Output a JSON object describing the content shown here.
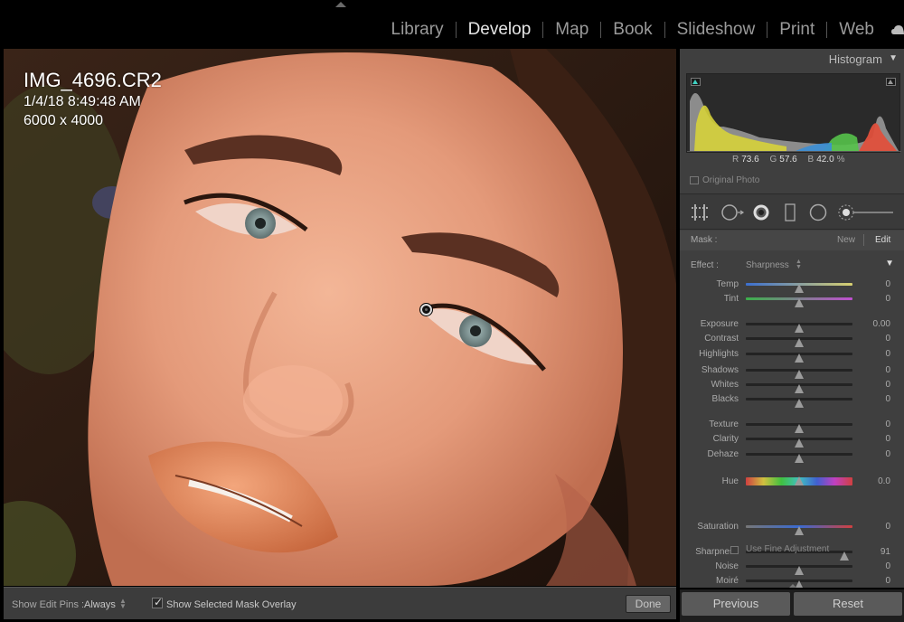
{
  "modules": {
    "items": [
      "Library",
      "Develop",
      "Map",
      "Book",
      "Slideshow",
      "Print",
      "Web"
    ],
    "active": "Develop"
  },
  "photo": {
    "filename": "IMG_4696.CR2",
    "date": "1/4/18 8:49:48 AM",
    "dimensions": "6000 x 4000"
  },
  "toolbar": {
    "show_edit_pins_label": "Show Edit Pins :",
    "show_edit_pins_value": "Always",
    "mask_overlay_label": "Show Selected Mask Overlay",
    "mask_overlay_checked": true,
    "done_label": "Done"
  },
  "histogram": {
    "title": "Histogram",
    "r_label": "R",
    "r_value": "73.6",
    "g_label": "G",
    "g_value": "57.6",
    "b_label": "B",
    "b_value": "42.0",
    "percent": "%",
    "original_photo_label": "Original Photo"
  },
  "mask": {
    "label": "Mask :",
    "new_label": "New",
    "edit_label": "Edit"
  },
  "effect": {
    "label": "Effect :",
    "value": "Sharpness"
  },
  "sliders": [
    {
      "label": "Temp",
      "value": "0",
      "pos": 0.5,
      "track": "temp"
    },
    {
      "label": "Tint",
      "value": "0",
      "pos": 0.5,
      "track": "tint"
    },
    {
      "label": "Exposure",
      "value": "0.00",
      "pos": 0.5,
      "track": "plain"
    },
    {
      "label": "Contrast",
      "value": "0",
      "pos": 0.5,
      "track": "plain"
    },
    {
      "label": "Highlights",
      "value": "0",
      "pos": 0.5,
      "track": "plain"
    },
    {
      "label": "Shadows",
      "value": "0",
      "pos": 0.5,
      "track": "plain"
    },
    {
      "label": "Whites",
      "value": "0",
      "pos": 0.5,
      "track": "plain"
    },
    {
      "label": "Blacks",
      "value": "0",
      "pos": 0.5,
      "track": "plain"
    },
    {
      "label": "Texture",
      "value": "0",
      "pos": 0.5,
      "track": "plain"
    },
    {
      "label": "Clarity",
      "value": "0",
      "pos": 0.5,
      "track": "plain"
    },
    {
      "label": "Dehaze",
      "value": "0",
      "pos": 0.5,
      "track": "plain"
    },
    {
      "label": "Hue",
      "value": "0.0",
      "pos": 0.5,
      "track": "hue"
    },
    {
      "label": "Saturation",
      "value": "0",
      "pos": 0.5,
      "track": "saturation"
    },
    {
      "label": "Sharpness",
      "value": "91",
      "pos": 0.92,
      "track": "plain"
    },
    {
      "label": "Noise",
      "value": "0",
      "pos": 0.5,
      "track": "plain"
    },
    {
      "label": "Moiré",
      "value": "0",
      "pos": 0.5,
      "track": "plain"
    }
  ],
  "fine_adjustment_label": "Use Fine Adjustment",
  "buttons": {
    "previous": "Previous",
    "reset": "Reset"
  },
  "colors": {
    "accent_active": "#e6e6e6",
    "panel_bg": "#3f3f3f",
    "skin": "#e8a383"
  }
}
